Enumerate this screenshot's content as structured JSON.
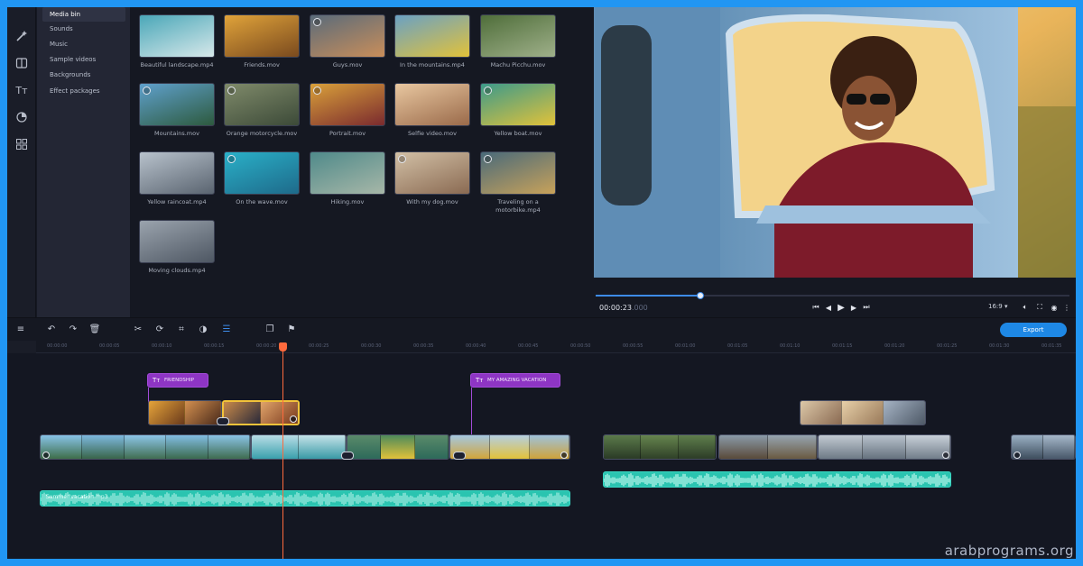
{
  "categories": [
    {
      "label": "Media bin",
      "active": true
    },
    {
      "label": "Sounds",
      "active": false
    },
    {
      "label": "Music",
      "active": false
    },
    {
      "label": "Sample videos",
      "active": false
    },
    {
      "label": "Backgrounds",
      "active": false
    },
    {
      "label": "Effect packages",
      "active": false
    }
  ],
  "media": [
    {
      "label": "Beautiful landscape.mp4",
      "c1": "#4aa7b8",
      "c2": "#d7e8ea",
      "badge": false
    },
    {
      "label": "Friends.mov",
      "c1": "#e0a33a",
      "c2": "#7a4a1e",
      "badge": false
    },
    {
      "label": "Guys.mov",
      "c1": "#5a6b7a",
      "c2": "#c98e5a",
      "badge": true
    },
    {
      "label": "In the mountains.mp4",
      "c1": "#6aa1c4",
      "c2": "#e2c23a",
      "badge": false
    },
    {
      "label": "Machu Picchu.mov",
      "c1": "#4f6e3a",
      "c2": "#9fb08a",
      "badge": false
    },
    {
      "label": "Mountains.mov",
      "c1": "#5fa0cc",
      "c2": "#2d5a3e",
      "badge": true
    },
    {
      "label": "Orange motorcycle.mov",
      "c1": "#7f8a6a",
      "c2": "#3c4a38",
      "badge": true
    },
    {
      "label": "Portrait.mov",
      "c1": "#d9a03a",
      "c2": "#7a2a2e",
      "badge": true
    },
    {
      "label": "Selfie video.mov",
      "c1": "#e8c7a0",
      "c2": "#9a6a4a",
      "badge": false
    },
    {
      "label": "Yellow boat.mov",
      "c1": "#3d9a8a",
      "c2": "#e1c23a",
      "badge": true
    },
    {
      "label": "Yellow raincoat.mp4",
      "c1": "#b8c2cc",
      "c2": "#5a6470",
      "badge": false
    },
    {
      "label": "On the wave.mov",
      "c1": "#2ab0c8",
      "c2": "#1e6a8a",
      "badge": true
    },
    {
      "label": "Hiking.mov",
      "c1": "#4f8a8a",
      "c2": "#a7b7a8",
      "badge": false
    },
    {
      "label": "With my dog.mov",
      "c1": "#d2c0a6",
      "c2": "#8a6a52",
      "badge": true
    },
    {
      "label": "Traveling on a motorbike.mp4",
      "c1": "#4a6a7a",
      "c2": "#c8a25a",
      "badge": true
    },
    {
      "label": "Moving clouds.mp4",
      "c1": "#9aa3ad",
      "c2": "#4e5763",
      "badge": false
    }
  ],
  "preview": {
    "time_current": "00:00:23",
    "time_rest": ".000",
    "aspect": "16:9 ▾",
    "progress": 0.22
  },
  "toolbar": {
    "export_label": "Export"
  },
  "ruler_ticks": [
    "00:00:00",
    "00:00:05",
    "00:00:10",
    "00:00:15",
    "00:00:20",
    "00:00:25",
    "00:00:30",
    "00:00:35",
    "00:00:40",
    "00:00:45",
    "00:00:50",
    "00:00:55",
    "00:01:00",
    "00:01:05",
    "00:01:10",
    "00:01:15",
    "00:01:20",
    "00:01:25",
    "00:01:30",
    "00:01:35"
  ],
  "timeline": {
    "title_1": "FRIENDSHIP",
    "title_2": "MY AMAZING VACATION",
    "audio_1": "Summer vacation.mp3"
  },
  "watermark": "arabprograms.org",
  "colors": {
    "accent": "#1e88e5",
    "title_clip": "#8e35c4",
    "audio_clip": "#2ac4b0",
    "playhead": "#ff6a3d",
    "selection": "#f2c33a"
  }
}
